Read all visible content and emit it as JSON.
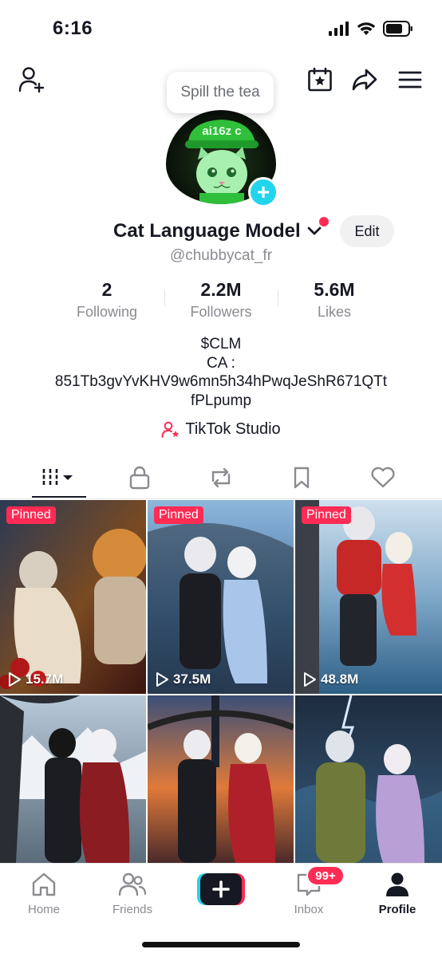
{
  "status": {
    "time": "6:16",
    "icons": [
      "signal-icon",
      "wifi-icon",
      "battery-icon"
    ]
  },
  "top_nav": {
    "icons": [
      "add-friend-icon",
      "calendar-star-icon",
      "share-icon",
      "menu-icon"
    ]
  },
  "tooltip": {
    "text": "Spill the tea"
  },
  "avatar": {
    "text": "ai16z c"
  },
  "profile": {
    "display_name": "Cat Language Model",
    "username": "@chubbycat_fr",
    "edit_label": "Edit"
  },
  "stats": [
    {
      "value": "2",
      "label": "Following"
    },
    {
      "value": "2.2M",
      "label": "Followers"
    },
    {
      "value": "5.6M",
      "label": "Likes"
    }
  ],
  "bio": {
    "lines": [
      "$CLM",
      "CA :",
      "851Tb3gvYvKHV9w6mn5h34hPwqJeShR671QTt",
      "fPLpump"
    ]
  },
  "studio": {
    "label": "TikTok Studio"
  },
  "tabs": [
    "videos-grid-icon",
    "lock-icon",
    "repost-icon",
    "bookmark-icon",
    "heart-icon"
  ],
  "videos": [
    {
      "pinned_label": "Pinned",
      "views": "15.7M"
    },
    {
      "pinned_label": "Pinned",
      "views": "37.5M"
    },
    {
      "pinned_label": "Pinned",
      "views": "48.8M"
    },
    {
      "pinned_label": "",
      "views": ""
    },
    {
      "pinned_label": "",
      "views": ""
    },
    {
      "pinned_label": "",
      "views": ""
    }
  ],
  "bottom_nav": {
    "home": "Home",
    "friends": "Friends",
    "inbox": "Inbox",
    "inbox_badge": "99+",
    "profile": "Profile"
  },
  "colors": {
    "accent_red": "#fe2c55",
    "accent_cyan": "#20d5ec",
    "text_primary": "#161823",
    "text_secondary": "#8a8b91"
  }
}
